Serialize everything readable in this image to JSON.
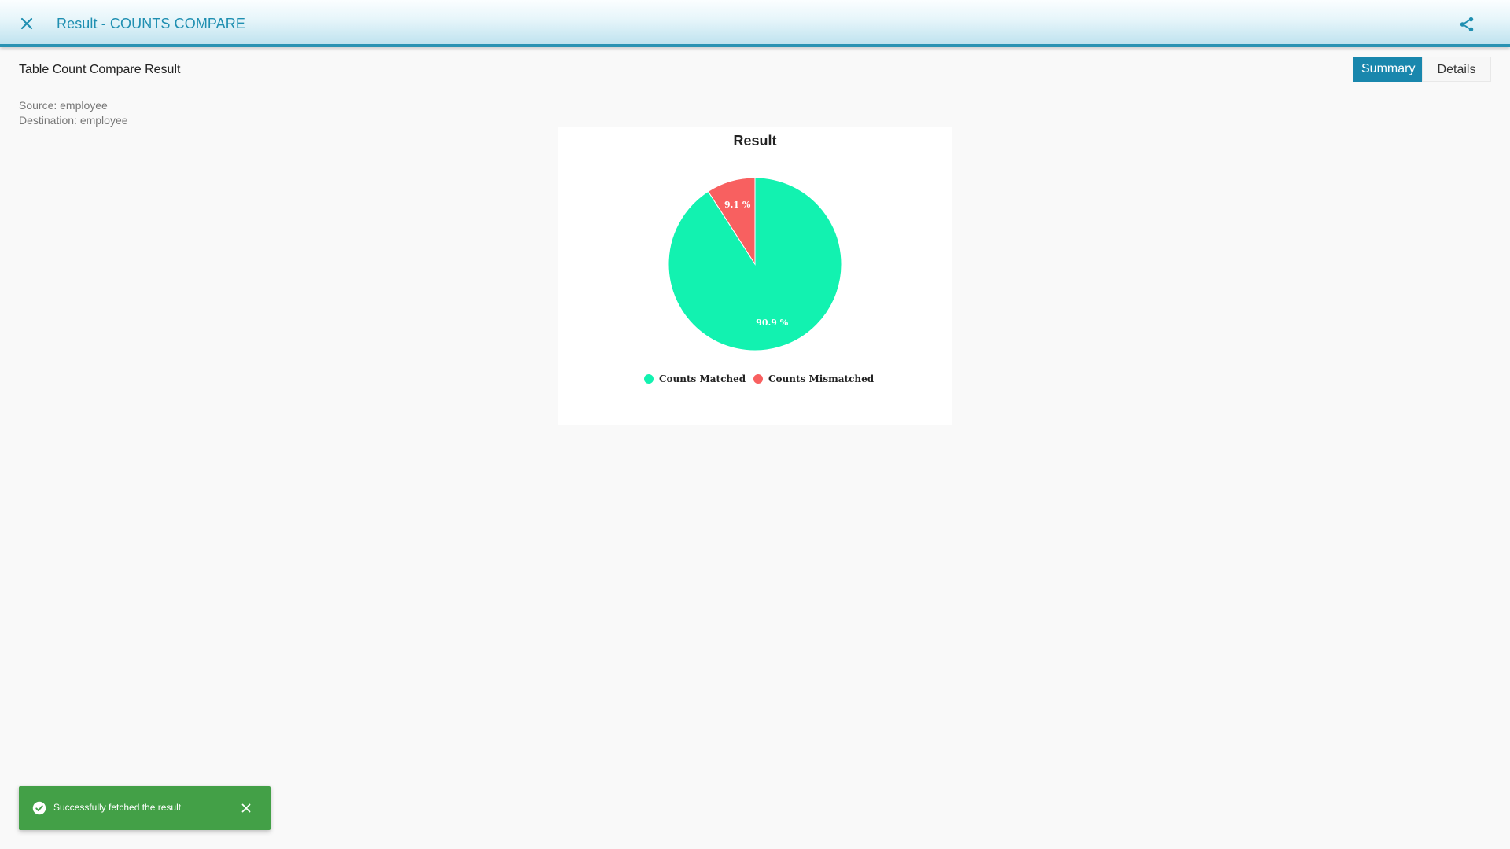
{
  "header": {
    "title": "Result - COUNTS COMPARE",
    "close_icon": "close-icon",
    "share_icon": "share-icon",
    "accent_color": "#1f8fb1"
  },
  "page": {
    "heading": "Table Count Compare Result",
    "source": "Source: employee",
    "destination": "Destination: employee"
  },
  "tabs": [
    {
      "label": "Summary",
      "active": true
    },
    {
      "label": "Details",
      "active": false
    }
  ],
  "chart_data": {
    "type": "pie",
    "title": "Result",
    "categories": [
      "Counts Matched",
      "Counts Mismatched"
    ],
    "values": [
      90.9,
      9.1
    ],
    "data_labels": [
      "90.9 %",
      "9.1 %"
    ],
    "colors": [
      "#12f2b0",
      "#f86060"
    ],
    "legend_position": "bottom"
  },
  "toast": {
    "message": "Successfully fetched the result",
    "icon": "check-circle-icon",
    "close_icon": "close-icon",
    "color": "#43a047"
  }
}
